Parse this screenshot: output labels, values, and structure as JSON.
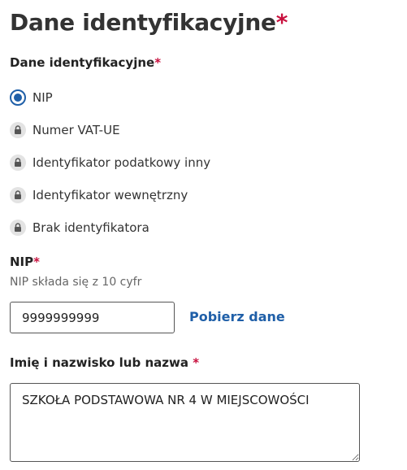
{
  "page": {
    "title": "Dane identyfikacyjne",
    "required_mark": "*"
  },
  "identification": {
    "label": "Dane identyfikacyjne",
    "required_mark": "*",
    "options": [
      {
        "label": "NIP",
        "state": "selected",
        "icon": "radio-selected"
      },
      {
        "label": "Numer VAT-UE",
        "state": "locked",
        "icon": "lock-icon"
      },
      {
        "label": "Identyfikator podatkowy inny",
        "state": "locked",
        "icon": "lock-icon"
      },
      {
        "label": "Identyfikator wewnętrzny",
        "state": "locked",
        "icon": "lock-icon"
      },
      {
        "label": "Brak identyfikatora",
        "state": "locked",
        "icon": "lock-icon"
      }
    ]
  },
  "nip": {
    "label": "NIP",
    "required_mark": "*",
    "hint": "NIP składa się z 10 cyfr",
    "value": "9999999999",
    "fetch_label": "Pobierz dane"
  },
  "name": {
    "label": "Imię i nazwisko lub nazwa",
    "required_mark": "*",
    "value": "SZKOŁA PODSTAWOWA NR 4 W MIEJSCOWOŚCI"
  },
  "colors": {
    "accent": "#1f5fa8",
    "required": "#c8103e",
    "lock_bg": "#e3e3e3"
  }
}
